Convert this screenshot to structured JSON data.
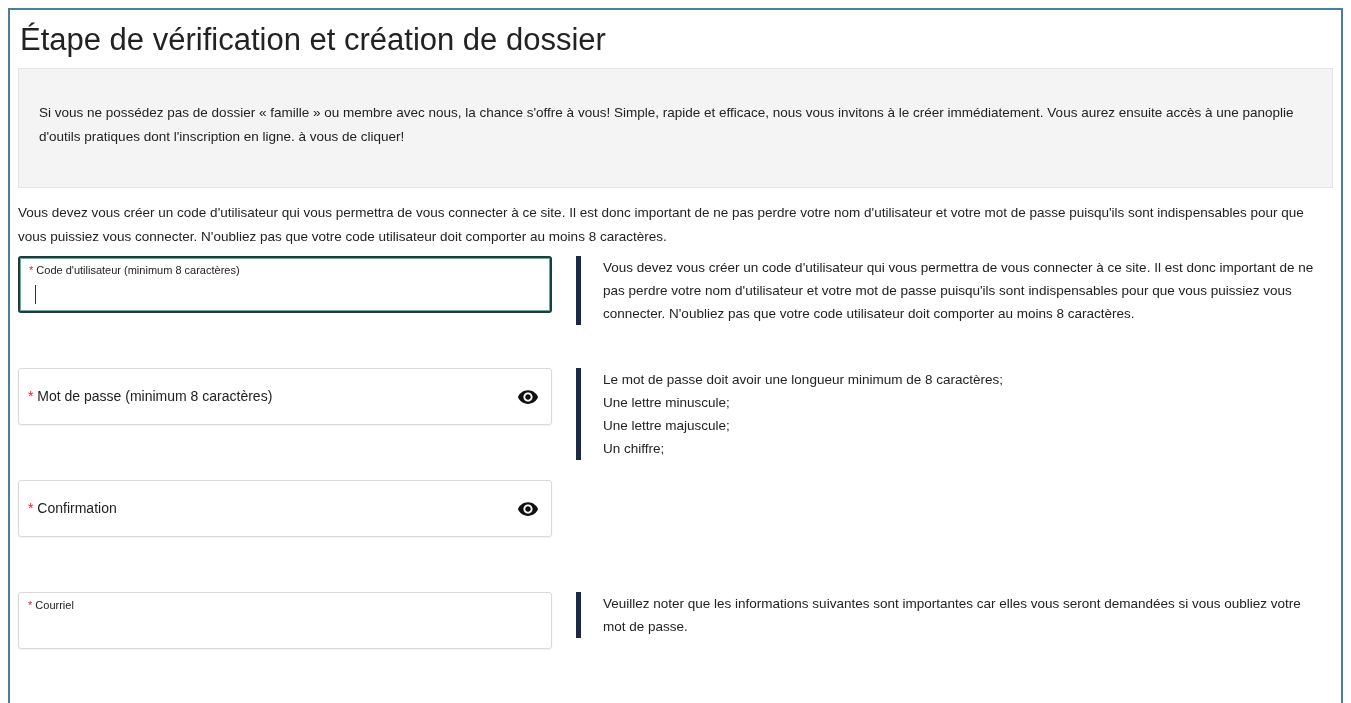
{
  "title": "Étape de vérification et création de dossier",
  "notice": "Si vous ne possédez pas de dossier « famille » ou membre avec nous, la chance s'offre à vous! Simple, rapide et efficace, nous vous invitons à le créer immédiatement. Vous aurez ensuite accès à une panoplie d'outils pratiques dont l'inscription en ligne. à vous de cliquer!",
  "intro": "Vous devez vous créer un code d'utilisateur qui vous permettra de vous connecter à ce site. Il est donc important de ne pas perdre votre nom d'utilisateur et votre mot de passe puisqu'ils sont indispensables pour que vous puissiez vous connecter. N'oubliez pas que votre code utilisateur doit comporter au moins 8 caractères.",
  "fields": [
    {
      "label": "Code d'utilisateur (minimum 8 caractères)",
      "required": "*",
      "floated": true,
      "focused": true,
      "reveal_toggle": false,
      "help": [
        "Vous devez vous créer un code d'utilisateur qui vous permettra de vous connecter à ce site. Il est donc important de ne pas perdre votre nom d'utilisateur et votre mot de passe puisqu'ils sont indispensables pour que vous puissiez vous connecter. N'oubliez pas que votre code utilisateur doit comporter au moins 8 caractères."
      ]
    },
    {
      "label": "Mot de passe (minimum 8 caractères)",
      "required": "*",
      "floated": false,
      "focused": false,
      "reveal_toggle": true,
      "help": [
        "Le mot de passe doit avoir une longueur minimum de 8 caractères;",
        "Une lettre minuscule;",
        "Une lettre majuscule;",
        "Un chiffre;"
      ]
    },
    {
      "label": "Confirmation",
      "required": "*",
      "floated": false,
      "focused": false,
      "reveal_toggle": true
    },
    {
      "label": "Courriel",
      "required": "*",
      "floated": true,
      "focused": false,
      "reveal_toggle": false,
      "help": [
        "Veuillez noter que les informations suivantes sont importantes car elles vous seront demandées si vous oubliez votre mot de passe."
      ]
    }
  ]
}
